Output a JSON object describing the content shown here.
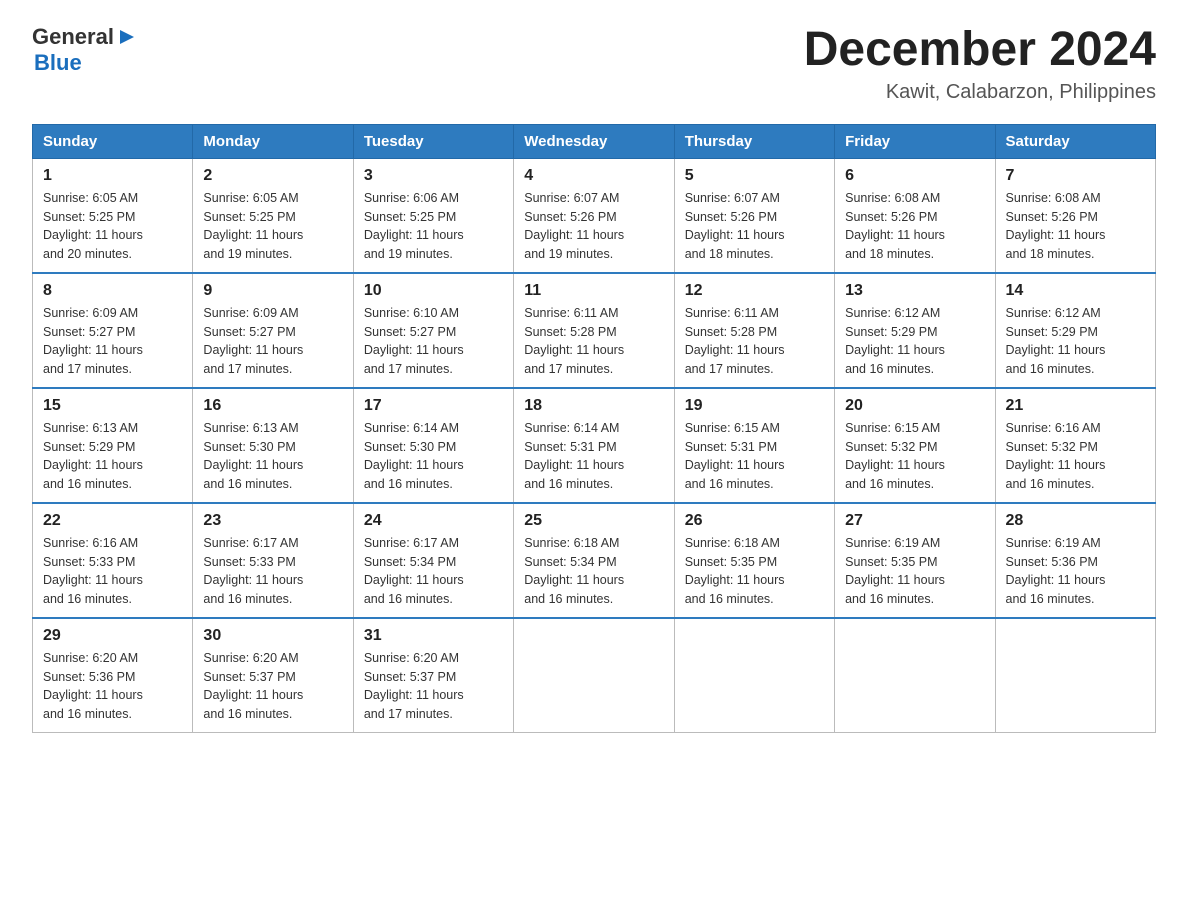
{
  "header": {
    "logo": {
      "text_general": "General",
      "text_blue": "Blue",
      "arrow": "▶"
    },
    "title": "December 2024",
    "subtitle": "Kawit, Calabarzon, Philippines"
  },
  "weekdays": [
    "Sunday",
    "Monday",
    "Tuesday",
    "Wednesday",
    "Thursday",
    "Friday",
    "Saturday"
  ],
  "weeks": [
    [
      {
        "day": "1",
        "sunrise": "6:05 AM",
        "sunset": "5:25 PM",
        "daylight": "11 hours and 20 minutes."
      },
      {
        "day": "2",
        "sunrise": "6:05 AM",
        "sunset": "5:25 PM",
        "daylight": "11 hours and 19 minutes."
      },
      {
        "day": "3",
        "sunrise": "6:06 AM",
        "sunset": "5:25 PM",
        "daylight": "11 hours and 19 minutes."
      },
      {
        "day": "4",
        "sunrise": "6:07 AM",
        "sunset": "5:26 PM",
        "daylight": "11 hours and 19 minutes."
      },
      {
        "day": "5",
        "sunrise": "6:07 AM",
        "sunset": "5:26 PM",
        "daylight": "11 hours and 18 minutes."
      },
      {
        "day": "6",
        "sunrise": "6:08 AM",
        "sunset": "5:26 PM",
        "daylight": "11 hours and 18 minutes."
      },
      {
        "day": "7",
        "sunrise": "6:08 AM",
        "sunset": "5:26 PM",
        "daylight": "11 hours and 18 minutes."
      }
    ],
    [
      {
        "day": "8",
        "sunrise": "6:09 AM",
        "sunset": "5:27 PM",
        "daylight": "11 hours and 17 minutes."
      },
      {
        "day": "9",
        "sunrise": "6:09 AM",
        "sunset": "5:27 PM",
        "daylight": "11 hours and 17 minutes."
      },
      {
        "day": "10",
        "sunrise": "6:10 AM",
        "sunset": "5:27 PM",
        "daylight": "11 hours and 17 minutes."
      },
      {
        "day": "11",
        "sunrise": "6:11 AM",
        "sunset": "5:28 PM",
        "daylight": "11 hours and 17 minutes."
      },
      {
        "day": "12",
        "sunrise": "6:11 AM",
        "sunset": "5:28 PM",
        "daylight": "11 hours and 17 minutes."
      },
      {
        "day": "13",
        "sunrise": "6:12 AM",
        "sunset": "5:29 PM",
        "daylight": "11 hours and 16 minutes."
      },
      {
        "day": "14",
        "sunrise": "6:12 AM",
        "sunset": "5:29 PM",
        "daylight": "11 hours and 16 minutes."
      }
    ],
    [
      {
        "day": "15",
        "sunrise": "6:13 AM",
        "sunset": "5:29 PM",
        "daylight": "11 hours and 16 minutes."
      },
      {
        "day": "16",
        "sunrise": "6:13 AM",
        "sunset": "5:30 PM",
        "daylight": "11 hours and 16 minutes."
      },
      {
        "day": "17",
        "sunrise": "6:14 AM",
        "sunset": "5:30 PM",
        "daylight": "11 hours and 16 minutes."
      },
      {
        "day": "18",
        "sunrise": "6:14 AM",
        "sunset": "5:31 PM",
        "daylight": "11 hours and 16 minutes."
      },
      {
        "day": "19",
        "sunrise": "6:15 AM",
        "sunset": "5:31 PM",
        "daylight": "11 hours and 16 minutes."
      },
      {
        "day": "20",
        "sunrise": "6:15 AM",
        "sunset": "5:32 PM",
        "daylight": "11 hours and 16 minutes."
      },
      {
        "day": "21",
        "sunrise": "6:16 AM",
        "sunset": "5:32 PM",
        "daylight": "11 hours and 16 minutes."
      }
    ],
    [
      {
        "day": "22",
        "sunrise": "6:16 AM",
        "sunset": "5:33 PM",
        "daylight": "11 hours and 16 minutes."
      },
      {
        "day": "23",
        "sunrise": "6:17 AM",
        "sunset": "5:33 PM",
        "daylight": "11 hours and 16 minutes."
      },
      {
        "day": "24",
        "sunrise": "6:17 AM",
        "sunset": "5:34 PM",
        "daylight": "11 hours and 16 minutes."
      },
      {
        "day": "25",
        "sunrise": "6:18 AM",
        "sunset": "5:34 PM",
        "daylight": "11 hours and 16 minutes."
      },
      {
        "day": "26",
        "sunrise": "6:18 AM",
        "sunset": "5:35 PM",
        "daylight": "11 hours and 16 minutes."
      },
      {
        "day": "27",
        "sunrise": "6:19 AM",
        "sunset": "5:35 PM",
        "daylight": "11 hours and 16 minutes."
      },
      {
        "day": "28",
        "sunrise": "6:19 AM",
        "sunset": "5:36 PM",
        "daylight": "11 hours and 16 minutes."
      }
    ],
    [
      {
        "day": "29",
        "sunrise": "6:20 AM",
        "sunset": "5:36 PM",
        "daylight": "11 hours and 16 minutes."
      },
      {
        "day": "30",
        "sunrise": "6:20 AM",
        "sunset": "5:37 PM",
        "daylight": "11 hours and 16 minutes."
      },
      {
        "day": "31",
        "sunrise": "6:20 AM",
        "sunset": "5:37 PM",
        "daylight": "11 hours and 17 minutes."
      },
      null,
      null,
      null,
      null
    ]
  ],
  "labels": {
    "sunrise": "Sunrise:",
    "sunset": "Sunset:",
    "daylight": "Daylight:"
  }
}
